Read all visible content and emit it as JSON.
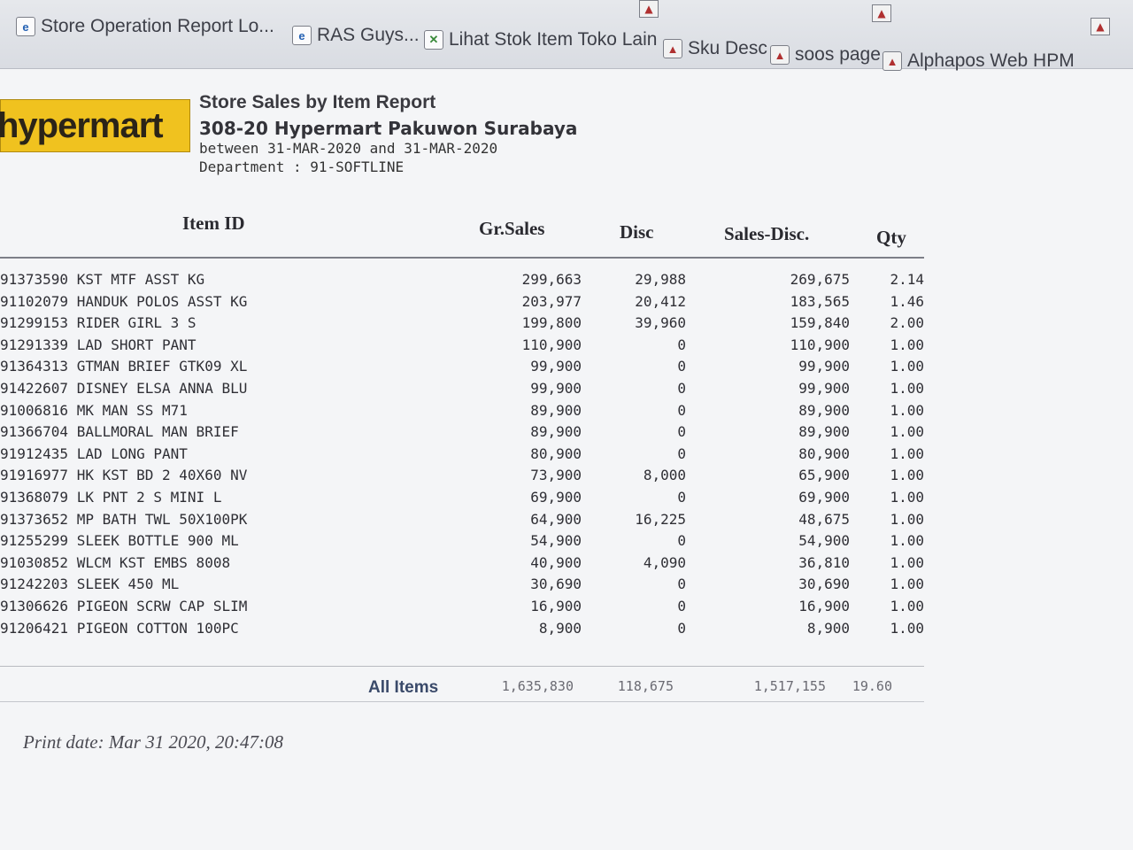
{
  "favorites": [
    {
      "label": "Store Operation Report Lo...",
      "icon": "ie-page-icon"
    },
    {
      "label": "RAS Guys...",
      "icon": "ie-page-icon"
    },
    {
      "label": "Lihat Stok Item Toko Lain",
      "icon": "stock-page-icon"
    },
    {
      "label": "Sku Desc",
      "icon": "broken-image-icon"
    },
    {
      "label": "soos page",
      "icon": "broken-image-icon"
    },
    {
      "label": "Alphapos Web HPM",
      "icon": "broken-image-icon"
    }
  ],
  "report": {
    "logo_text": "hypermart",
    "title": "Store Sales by Item Report",
    "store": "308-20 Hypermart Pakuwon Surabaya",
    "range": "between 31-MAR-2020 and 31-MAR-2020",
    "department": "Department : 91-SOFTLINE"
  },
  "columns": {
    "item_id": "Item ID",
    "gross": "Gr.Sales",
    "disc": "Disc",
    "net": "Sales-Disc.",
    "qty": "Qty"
  },
  "rows": [
    {
      "item": "91373590 KST MTF ASST KG",
      "gross": "299,663",
      "disc": "29,988",
      "net": "269,675",
      "qty": "2.14"
    },
    {
      "item": "91102079 HANDUK POLOS ASST KG",
      "gross": "203,977",
      "disc": "20,412",
      "net": "183,565",
      "qty": "1.46"
    },
    {
      "item": "91299153 RIDER GIRL 3 S",
      "gross": "199,800",
      "disc": "39,960",
      "net": "159,840",
      "qty": "2.00"
    },
    {
      "item": "91291339 LAD SHORT PANT",
      "gross": "110,900",
      "disc": "0",
      "net": "110,900",
      "qty": "1.00"
    },
    {
      "item": "91364313 GTMAN BRIEF GTK09 XL",
      "gross": "99,900",
      "disc": "0",
      "net": "99,900",
      "qty": "1.00"
    },
    {
      "item": "91422607 DISNEY ELSA ANNA BLU",
      "gross": "99,900",
      "disc": "0",
      "net": "99,900",
      "qty": "1.00"
    },
    {
      "item": "91006816 MK MAN SS M71",
      "gross": "89,900",
      "disc": "0",
      "net": "89,900",
      "qty": "1.00"
    },
    {
      "item": "91366704 BALLMORAL MAN BRIEF",
      "gross": "89,900",
      "disc": "0",
      "net": "89,900",
      "qty": "1.00"
    },
    {
      "item": "91912435 LAD LONG PANT",
      "gross": "80,900",
      "disc": "0",
      "net": "80,900",
      "qty": "1.00"
    },
    {
      "item": "91916977 HK KST BD 2 40X60 NV",
      "gross": "73,900",
      "disc": "8,000",
      "net": "65,900",
      "qty": "1.00"
    },
    {
      "item": "91368079 LK PNT 2 S MINI L",
      "gross": "69,900",
      "disc": "0",
      "net": "69,900",
      "qty": "1.00"
    },
    {
      "item": "91373652 MP BATH TWL 50X100PK",
      "gross": "64,900",
      "disc": "16,225",
      "net": "48,675",
      "qty": "1.00"
    },
    {
      "item": "91255299 SLEEK BOTTLE 900 ML",
      "gross": "54,900",
      "disc": "0",
      "net": "54,900",
      "qty": "1.00"
    },
    {
      "item": "91030852 WLCM KST EMBS 8008",
      "gross": "40,900",
      "disc": "4,090",
      "net": "36,810",
      "qty": "1.00"
    },
    {
      "item": "91242203 SLEEK 450 ML",
      "gross": "30,690",
      "disc": "0",
      "net": "30,690",
      "qty": "1.00"
    },
    {
      "item": "91306626 PIGEON SCRW CAP SLIM",
      "gross": "16,900",
      "disc": "0",
      "net": "16,900",
      "qty": "1.00"
    },
    {
      "item": "91206421 PIGEON COTTON 100PC",
      "gross": "8,900",
      "disc": "0",
      "net": "8,900",
      "qty": "1.00"
    }
  ],
  "totals": {
    "label": "All Items",
    "gross": "1,635,830",
    "disc": "118,675",
    "net": "1,517,155",
    "qty": "19.60"
  },
  "print_date": "Print date: Mar 31 2020, 20:47:08",
  "colors": {
    "logo_bg": "#f0c21f",
    "page_bg": "#f4f5f7",
    "total_label": "#3a4a6a"
  }
}
